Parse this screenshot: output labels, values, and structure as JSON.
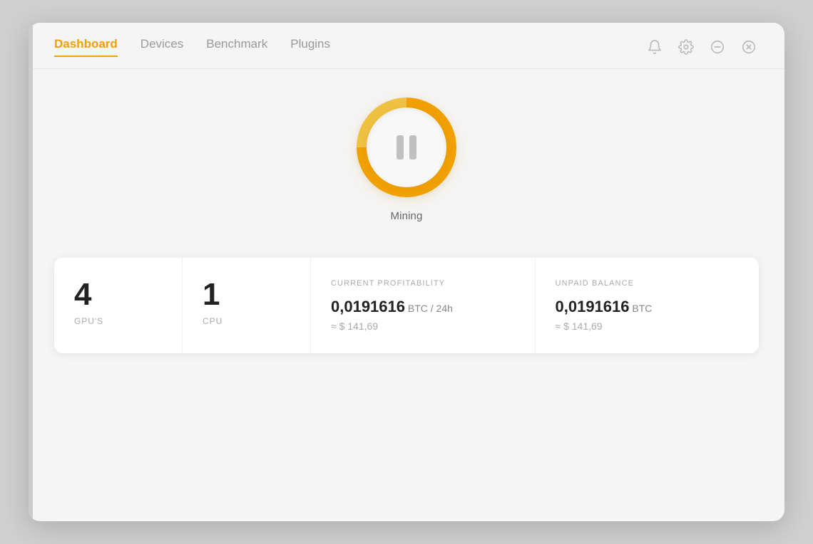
{
  "nav": {
    "items": [
      {
        "label": "Dashboard",
        "active": true
      },
      {
        "label": "Devices",
        "active": false
      },
      {
        "label": "Benchmark",
        "active": false
      },
      {
        "label": "Plugins",
        "active": false
      }
    ]
  },
  "header_icons": {
    "bell": "🔔",
    "settings": "⚙",
    "minimize": "⊖",
    "close": "⊗"
  },
  "mining": {
    "label": "Mining"
  },
  "stats": {
    "gpu": {
      "value": "4",
      "label": "GPU'S"
    },
    "cpu": {
      "value": "1",
      "label": "CPU"
    },
    "profitability": {
      "header": "CURRENT PROFITABILITY",
      "main_value": "0,0191616",
      "unit": " BTC / 24h",
      "sub_value": "≈ $ 141,69"
    },
    "balance": {
      "header": "UNPAID BALANCE",
      "main_value": "0,0191616",
      "unit": " BTC",
      "sub_value": "≈ $ 141,69"
    }
  }
}
